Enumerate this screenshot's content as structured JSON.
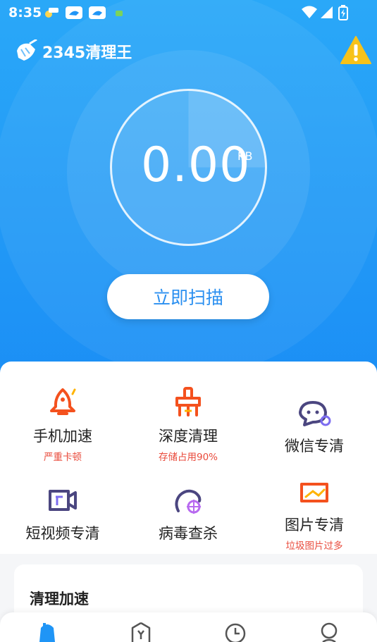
{
  "status_bar": {
    "time": "8:35",
    "notification_icons": [
      "weather-icon",
      "app-notification-icon",
      "app-notification-icon",
      "android-icon"
    ]
  },
  "header": {
    "app_name": "2345清理王",
    "warning_icon": "warning-triangle-icon"
  },
  "scan": {
    "size_value": "0.00",
    "size_unit": "KB",
    "progress": 0.25,
    "button_label": "立即扫描"
  },
  "features": [
    {
      "label": "手机加速",
      "sub": "严重卡顿",
      "icon": "rocket-icon"
    },
    {
      "label": "深度清理",
      "sub": "存储占用90%",
      "icon": "broom-icon"
    },
    {
      "label": "微信专清",
      "sub": "",
      "icon": "wechat-icon"
    },
    {
      "label": "短视频专清",
      "sub": "",
      "icon": "video-icon"
    },
    {
      "label": "病毒查杀",
      "sub": "",
      "icon": "virus-icon"
    },
    {
      "label": "图片专清",
      "sub": "垃圾图片过多",
      "icon": "picture-icon"
    }
  ],
  "section": {
    "title": "清理加速"
  },
  "bottom_nav": [
    "home-icon",
    "tools-icon",
    "clock-icon",
    "profile-icon"
  ],
  "colors": {
    "accent": "#1f95f6",
    "warning": "#f7c21a",
    "sub_text_red": "#e94b3c",
    "icon_orange": "#f4511e",
    "icon_purple": "#4b4680"
  }
}
